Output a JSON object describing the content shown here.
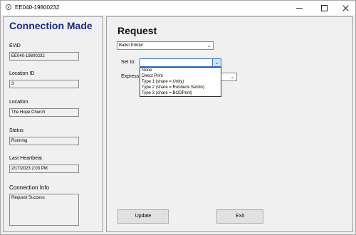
{
  "window": {
    "title": "EE040-19800232"
  },
  "left": {
    "heading": "Connection Made",
    "evid_label": "EViD",
    "evid_value": "EE040-19800232",
    "location_id_label": "Location ID",
    "location_id_value": "3",
    "location_label": "Location",
    "location_value": "The Hope Church",
    "status_label": "Status",
    "status_value": "Running",
    "heartbeat_label": "Last Heartbeat",
    "heartbeat_value": "2/17/2023 2:03 PM",
    "conn_info_label": "Connection Info",
    "conn_info_value": "Request Success"
  },
  "right": {
    "heading": "Request",
    "request_type": "Ballot Printer",
    "set_to_label": "Set to:",
    "express_label": "Express",
    "options": [
      "None",
      "Direct Print",
      "Type 1 (share = Unity)",
      "Type 2 (share = Runbeck.Sentio)",
      "Type 3 (share = BODPrint)"
    ],
    "update_label": "Update",
    "exit_label": "Exit"
  }
}
